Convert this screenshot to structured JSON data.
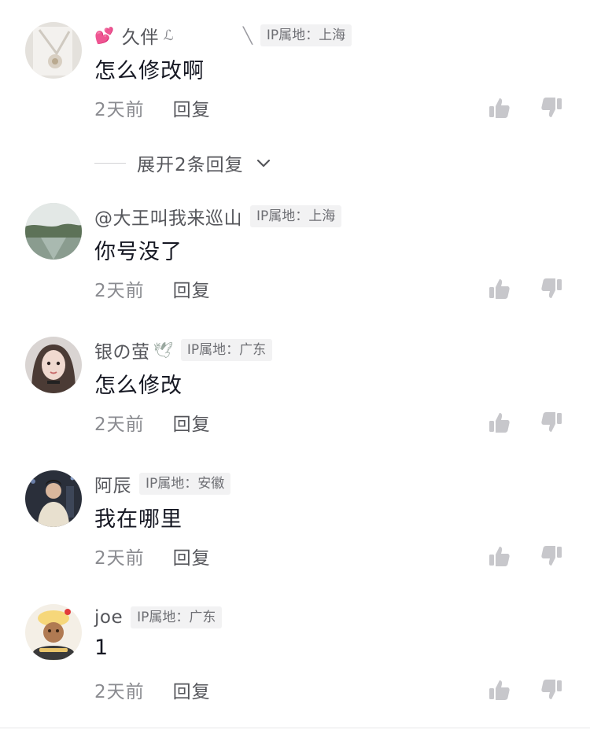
{
  "comments": [
    {
      "username": "久伴",
      "emoji": "💕",
      "sig": "ℒ",
      "ip": "IP属地：上海",
      "text": "怎么修改啊",
      "time": "2天前",
      "reply": "回复"
    },
    {
      "username": "@大王叫我来巡山",
      "ip": "IP属地：上海",
      "text": "你号没了",
      "time": "2天前",
      "reply": "回复"
    },
    {
      "username": "银の萤",
      "emoji": "🕊",
      "ip": "IP属地：广东",
      "text": "怎么修改",
      "time": "2天前",
      "reply": "回复"
    },
    {
      "username": "阿辰",
      "ip": "IP属地：安徽",
      "text": "我在哪里",
      "time": "2天前",
      "reply": "回复"
    },
    {
      "username": "joe",
      "ip": "IP属地：广东",
      "text": "1",
      "time": "2天前",
      "reply": "回复"
    }
  ],
  "expand": {
    "label": "展开2条回复"
  },
  "icons": {
    "like": "thumbs-up-icon",
    "dislike": "thumbs-down-icon",
    "expand": "chevron-down-icon"
  },
  "colors": {
    "text_primary": "#161823",
    "text_secondary": "#8a8b90",
    "badge_bg": "#f2f2f3",
    "icon_gray": "#c7c7cb"
  }
}
